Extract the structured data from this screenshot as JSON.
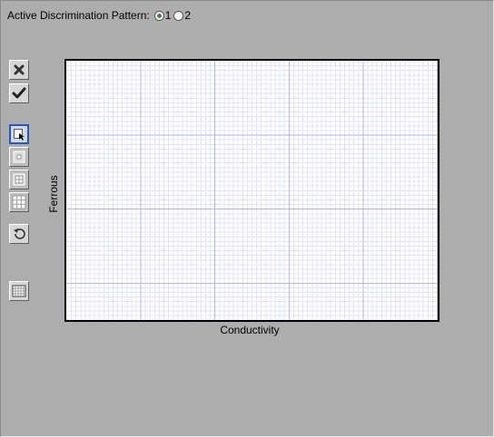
{
  "pattern": {
    "label": "Active Discrimination Pattern:",
    "options": [
      {
        "label": "1",
        "selected": true
      },
      {
        "label": "2",
        "selected": false
      }
    ]
  },
  "toolbar": {
    "items": [
      {
        "name": "delete-button",
        "icon": "x-icon",
        "active": false,
        "enabled": true
      },
      {
        "name": "accept-button",
        "icon": "checkmark-icon",
        "active": false,
        "enabled": true
      },
      {
        "name": "select-tool-button",
        "icon": "pointer-icon",
        "active": true,
        "enabled": true
      },
      {
        "name": "single-cell-tool-button",
        "icon": "small-square-icon",
        "active": false,
        "enabled": false
      },
      {
        "name": "medium-brush-tool-button",
        "icon": "four-square-icon",
        "active": false,
        "enabled": false
      },
      {
        "name": "large-brush-tool-button",
        "icon": "nine-square-icon",
        "active": false,
        "enabled": false
      },
      {
        "name": "undo-button",
        "icon": "undo-icon",
        "active": false,
        "enabled": true
      },
      {
        "name": "grid-toggle-button",
        "icon": "grid-icon",
        "active": false,
        "enabled": true
      }
    ]
  },
  "plot": {
    "xlabel": "Conductivity",
    "ylabel": "Ferrous",
    "minor_grid_color": "#e3e3f8",
    "major_grid_color": "#b6b6ee"
  }
}
